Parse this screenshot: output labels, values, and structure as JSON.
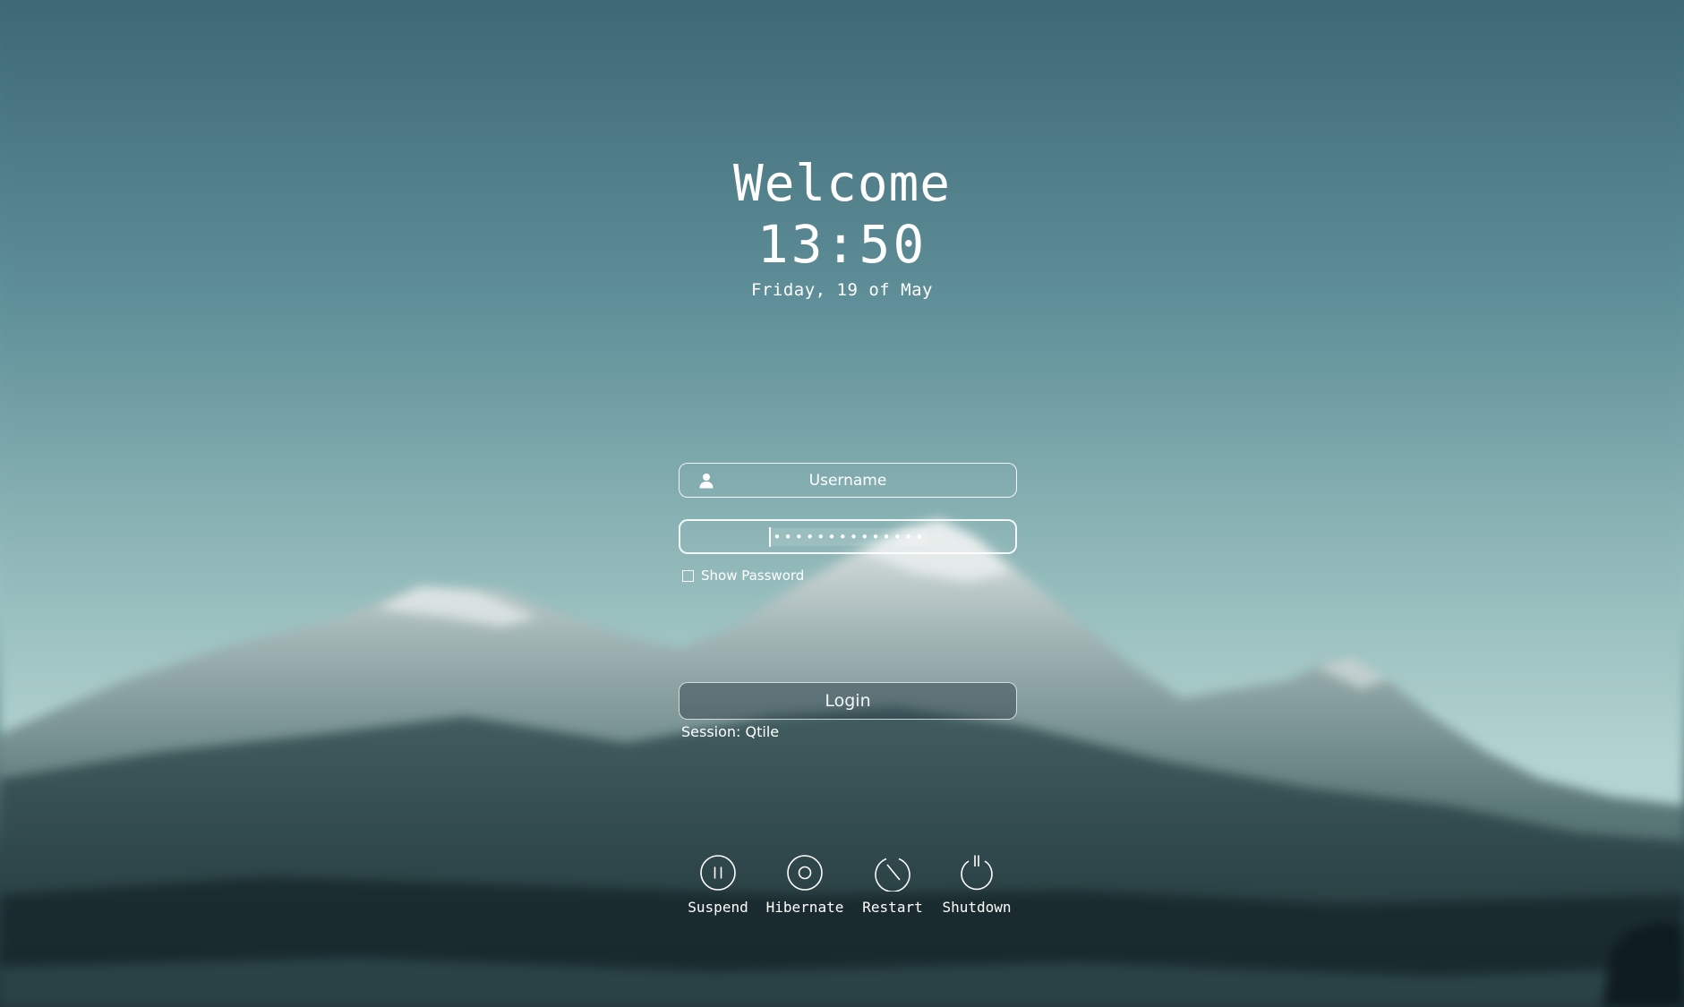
{
  "header": {
    "welcome": "Welcome",
    "time": "13:50",
    "date": "Friday, 19 of May"
  },
  "login_form": {
    "username_placeholder": "Username",
    "password_masked": "••••••••••••••",
    "show_password_label": "Show Password",
    "show_password_checked": false,
    "login_label": "Login",
    "session_text": "Session: Qtile"
  },
  "power_actions": [
    {
      "label": "Suspend",
      "icon": "pause-circle-icon"
    },
    {
      "label": "Hibernate",
      "icon": "circle-dot-icon"
    },
    {
      "label": "Restart",
      "icon": "restart-icon"
    },
    {
      "label": "Shutdown",
      "icon": "power-icon"
    }
  ],
  "colors": {
    "text": "#ffffff",
    "sky_top": "#3f6b78",
    "sky_bottom": "#9cc3c3",
    "mountain_dark": "#1f3338"
  }
}
